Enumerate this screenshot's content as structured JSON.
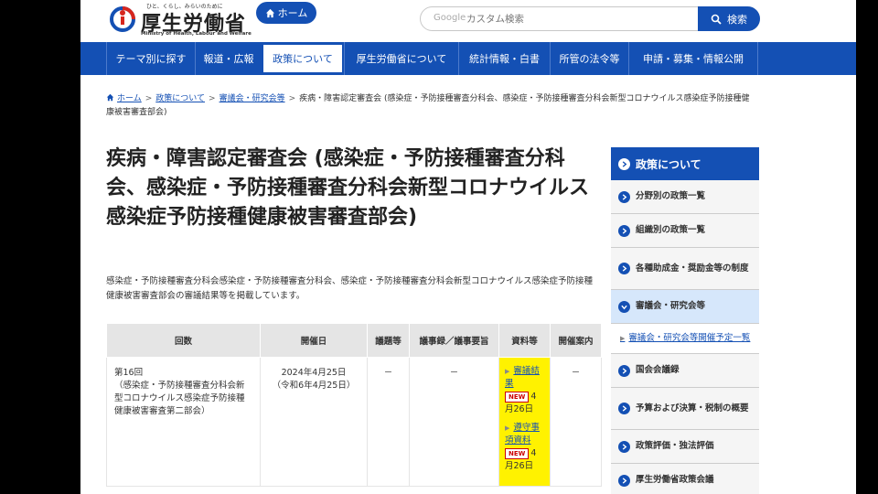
{
  "header": {
    "logo_tagline": "ひと、くらし、みらいのために",
    "logo_name": "厚生労働省",
    "logo_en": "Ministry of Health, Labour and Welfare",
    "home_label": "ホーム",
    "search_brand": "Google",
    "search_placeholder": "カスタム検索",
    "search_label": "検索"
  },
  "nav": {
    "items": [
      {
        "label": "テーマ別に探す"
      },
      {
        "label": "報道・広報"
      },
      {
        "label": "政策について"
      },
      {
        "label": "厚生労働省について"
      },
      {
        "label": "統計情報・白書"
      },
      {
        "label": "所管の法令等"
      },
      {
        "label": "申請・募集・情報公開"
      }
    ]
  },
  "breadcrumb": {
    "home": "ホーム",
    "policy": "政策について",
    "council": "審議会・研究会等",
    "current": "疾病・障害認定審査会 (感染症・予防接種審査分科会、感染症・予防接種審査分科会新型コロナウイルス感染症予防接種健康被害審査部会)"
  },
  "page": {
    "title": "疾病・障害認定審査会 (感染症・予防接種審査分科会、感染症・予防接種審査分科会新型コロナウイルス感染症予防接種健康被害審査部会)",
    "description": "感染症・予防接種審査分科会感染症・予防接種審査分科会、感染症・予防接種審査分科会新型コロナウイルス感染症予防接種健康被害審査部会の審議結果等を掲載しています。"
  },
  "table": {
    "headers": [
      "回数",
      "開催日",
      "議題等",
      "議事録／議事要旨",
      "資料等",
      "開催案内"
    ],
    "row": {
      "session": "第16回",
      "session_note": "（感染症・予防接種審査分科会新型コロナウイルス感染症予防接種健康被害審査第二部会）",
      "date": "2024年4月25日",
      "date_wareki": "（令和6年4月25日）",
      "agenda": "－",
      "minutes": "－",
      "notice": "－",
      "docs": [
        {
          "label": "審議結果",
          "badge": "NEW",
          "date": "4月26日"
        },
        {
          "label": "遵守事項資料",
          "badge": "NEW",
          "date": "4月26日"
        }
      ]
    }
  },
  "sidebar": {
    "heading": "政策について",
    "items": [
      {
        "label": "分野別の政策一覧"
      },
      {
        "label": "組織別の政策一覧"
      },
      {
        "label": "各種助成金・奨励金等の制度"
      },
      {
        "label": "審議会・研究会等"
      },
      {
        "label": "国会会議録"
      },
      {
        "label": "予算および決算・税制の概要"
      },
      {
        "label": "政策評価・独法評価"
      },
      {
        "label": "厚生労働省政策会議"
      }
    ],
    "sub_item": "審議会・研究会等開催予定一覧"
  },
  "colors": {
    "brand_blue": "#1450b4",
    "highlight_yellow": "#fff200",
    "new_badge_red": "#cc0000",
    "active_side": "#d6e7fb"
  }
}
